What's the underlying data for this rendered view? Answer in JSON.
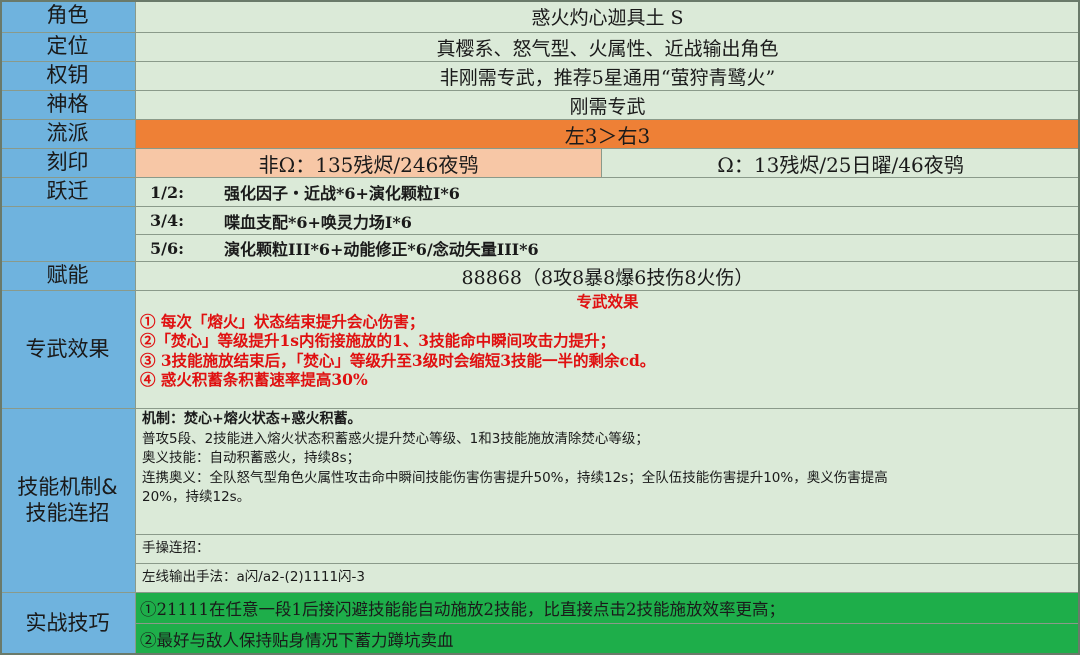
{
  "rows": {
    "role": {
      "label": "角色",
      "value": "惑火灼心迦具土 S"
    },
    "position": {
      "label": "定位",
      "value": "真樱系、怒气型、火属性、近战输出角色"
    },
    "key": {
      "label": "权钥",
      "value": "非刚需专武，推荐5星通用“萤狩青鹭火”"
    },
    "divine": {
      "label": "神格",
      "value": "刚需专武"
    },
    "school": {
      "label": "流派",
      "value": "左3＞右3"
    },
    "imprint": {
      "label": "刻印",
      "left": "非Ω：135残烬/246夜鸮",
      "right": "Ω：13残烬/25日曜/46夜鸮"
    },
    "leap": {
      "label": "跃迁",
      "items": [
        {
          "k": "1/2:",
          "v": "强化因子・近战*6+演化颗粒I*6"
        },
        {
          "k": "3/4:",
          "v": "喋血支配*6+唤灵力场I*6"
        },
        {
          "k": "5/6:",
          "v": "演化颗粒III*6+动能修正*6/念动矢量III*6"
        }
      ]
    },
    "talent": {
      "label": "赋能",
      "value": "88868（8攻8暴8爆6技伤8火伤）"
    },
    "weapon": {
      "label": "专武效果",
      "title": "专武效果",
      "lines": [
        "①  每次「熔火」状态结束提升会心伤害；",
        "②「焚心」等级提升1s内衔接施放的1、3技能命中瞬间攻击力提升；",
        "③  3技能施放结束后，「焚心」等级升至3级时会缩短3技能一半的剩余cd。",
        "④  惑火积蓄条积蓄速率提高30%"
      ]
    },
    "skill": {
      "label": "技能机制&技能连招",
      "mech_title": "机制：焚心+熔火状态+惑火积蓄。",
      "mech_lines": [
        "普攻5段、2技能进入熔火状态积蓄惑火提升焚心等级、1和3技能施放清除焚心等级；",
        "奥义技能：自动积蓄惑火，持续8s；",
        "连携奥义：全队怒气型角色火属性攻击命中瞬间技能伤害伤害提升50%，持续12s；全队伍技能伤害提升10%，奥义伤害提高",
        "20%，持续12s。"
      ],
      "combo_title": "手操连招：",
      "combo": "左线输出手法：a闪/a2-(2)1111闪-3"
    },
    "tips": {
      "label": "实战技巧",
      "lines": [
        "①21111在任意一段1后接闪避技能能自动施放2技能，比直接点击2技能施放效率更高；",
        "②最好与敌人保持贴身情况下蓄力蹲坑卖血"
      ]
    }
  },
  "colors": {
    "label_bg": "#6fb3de",
    "value_bg": "#dbead8",
    "orange": "#ee8036",
    "peach": "#f7c7a6",
    "green": "#1eae4a",
    "red": "#e01010"
  }
}
